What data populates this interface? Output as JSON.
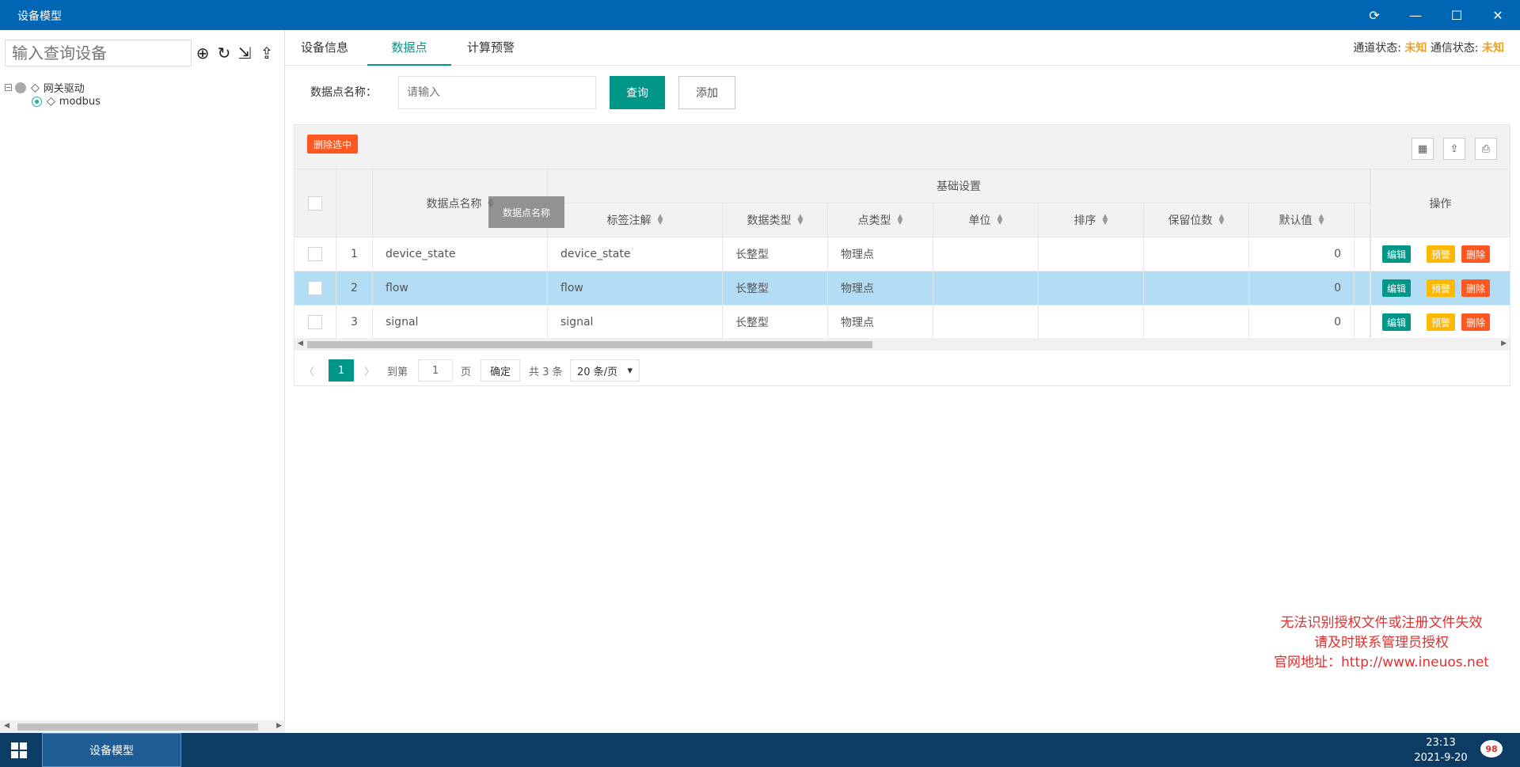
{
  "window": {
    "title": "设备模型"
  },
  "left": {
    "search_placeholder": "输入查询设备",
    "tree": [
      {
        "label": "网关驱动"
      },
      {
        "label": "modbus"
      }
    ]
  },
  "tabs": [
    {
      "label": "设备信息"
    },
    {
      "label": "数据点"
    },
    {
      "label": "计算预警"
    }
  ],
  "status": {
    "channel_label": "通道状态:",
    "channel_value": "未知",
    "comm_label": "通信状态:",
    "comm_value": "未知"
  },
  "search": {
    "label": "数据点名称：",
    "placeholder": "请输入",
    "query_label": "查询",
    "add_label": "添加"
  },
  "table": {
    "delete_selected_label": "删除选中",
    "group_header": "基础设置",
    "columns": [
      "数据点名称",
      "标签注解",
      "数据类型",
      "点类型",
      "单位",
      "排序",
      "保留位数",
      "默认值",
      "操作"
    ],
    "tooltip": "数据点名称",
    "rows": [
      {
        "index": "1",
        "name": "device_state",
        "label": "device_state",
        "data_type": "长整型",
        "point_type": "物理点",
        "unit": "",
        "order": "",
        "decimals": "",
        "default": "0"
      },
      {
        "index": "2",
        "name": "flow",
        "label": "flow",
        "data_type": "长整型",
        "point_type": "物理点",
        "unit": "",
        "order": "",
        "decimals": "",
        "default": "0"
      },
      {
        "index": "3",
        "name": "signal",
        "label": "signal",
        "data_type": "长整型",
        "point_type": "物理点",
        "unit": "",
        "order": "",
        "decimals": "",
        "default": "0"
      }
    ],
    "row_actions": {
      "edit": "编辑",
      "alert": "预警",
      "delete": "删除"
    },
    "selected_row": 2,
    "colors": {
      "accent": "#009688",
      "warn": "#ffb800",
      "danger": "#ff5722",
      "selected_row_bg": "#b3dcf5"
    }
  },
  "pager": {
    "current_page": "1",
    "goto_label": "到第",
    "page_input": "1",
    "page_unit": "页",
    "confirm_label": "确定",
    "total_label": "共 3 条",
    "page_size": "20 条/页"
  },
  "watermark": {
    "line1": "无法识别授权文件或注册文件失效",
    "line2": "请及时联系管理员授权",
    "line3": "官网地址：http://www.ineuos.net"
  },
  "taskbar": {
    "app_label": "设备模型",
    "time": "23:13",
    "date": "2021-9-20",
    "notification_count": "98"
  }
}
